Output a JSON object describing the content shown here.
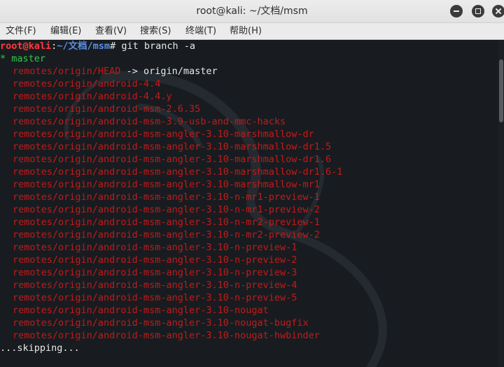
{
  "window": {
    "title": "root@kali: ~/文档/msm"
  },
  "menubar": [
    "文件(F)",
    "编辑(E)",
    "查看(V)",
    "搜索(S)",
    "终端(T)",
    "帮助(H)"
  ],
  "prompt": {
    "user_host": "root@kali",
    "separator": ":",
    "path": "~/文档/msm",
    "symbol": "#",
    "command": "git branch -a"
  },
  "current_branch": "* master",
  "head_line": {
    "ref": "remotes/origin/HEAD",
    "target": " -> origin/master"
  },
  "branches": [
    "remotes/origin/android-4.4",
    "remotes/origin/android-4.4.y",
    "remotes/origin/android-msm-2.6.35",
    "remotes/origin/android-msm-3.9-usb-and-mmc-hacks",
    "remotes/origin/android-msm-angler-3.10-marshmallow-dr",
    "remotes/origin/android-msm-angler-3.10-marshmallow-dr1.5",
    "remotes/origin/android-msm-angler-3.10-marshmallow-dr1.6",
    "remotes/origin/android-msm-angler-3.10-marshmallow-dr1.6-1",
    "remotes/origin/android-msm-angler-3.10-marshmallow-mr1",
    "remotes/origin/android-msm-angler-3.10-n-mr1-preview-1",
    "remotes/origin/android-msm-angler-3.10-n-mr1-preview-2",
    "remotes/origin/android-msm-angler-3.10-n-mr2-preview-1",
    "remotes/origin/android-msm-angler-3.10-n-mr2-preview-2",
    "remotes/origin/android-msm-angler-3.10-n-preview-1",
    "remotes/origin/android-msm-angler-3.10-n-preview-2",
    "remotes/origin/android-msm-angler-3.10-n-preview-3",
    "remotes/origin/android-msm-angler-3.10-n-preview-4",
    "remotes/origin/android-msm-angler-3.10-n-preview-5",
    "remotes/origin/android-msm-angler-3.10-nougat",
    "remotes/origin/android-msm-angler-3.10-nougat-bugfix",
    "remotes/origin/android-msm-angler-3.10-nougat-hwbinder"
  ],
  "pager_status": "...skipping...",
  "icons": {
    "minimize": "minimize-icon",
    "maximize": "maximize-icon",
    "close": "close-icon",
    "background_logo": "kali-dragon-logo"
  },
  "colors": {
    "background": "#181c20",
    "user_host": "#ff3b3b",
    "path": "#5c8fe6",
    "current_branch": "#33c94a",
    "remote_branch": "#c31a1a",
    "text": "#e8e8e8"
  }
}
